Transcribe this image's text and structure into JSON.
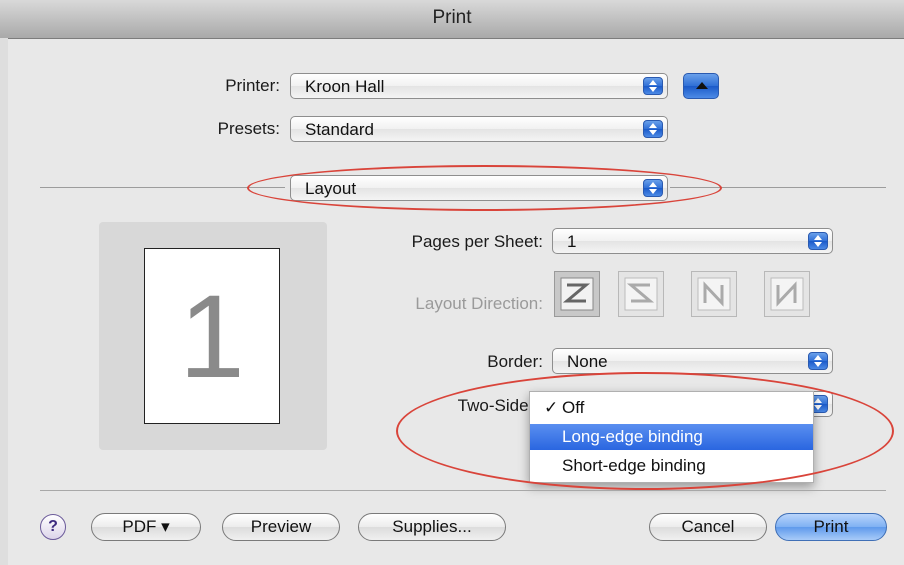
{
  "window": {
    "title": "Print"
  },
  "printer": {
    "label": "Printer:",
    "value": "Kroon Hall"
  },
  "presets": {
    "label": "Presets:",
    "value": "Standard"
  },
  "section": {
    "value": "Layout"
  },
  "preview": {
    "page_number": "1"
  },
  "pages_per_sheet": {
    "label": "Pages per Sheet:",
    "value": "1"
  },
  "layout_direction": {
    "label": "Layout Direction:"
  },
  "border": {
    "label": "Border:",
    "value": "None"
  },
  "two_sided": {
    "label": "Two-Sided",
    "options": [
      "Off",
      "Long-edge binding",
      "Short-edge binding"
    ],
    "checked_mark": "✓",
    "highlighted": "Long-edge binding"
  },
  "buttons": {
    "help": "?",
    "pdf": "PDF ▾",
    "preview": "Preview",
    "supplies": "Supplies...",
    "cancel": "Cancel",
    "print": "Print"
  },
  "colors": {
    "accent": "#2f6fd6",
    "annotation": "#d9443a",
    "highlight": "#3a74e6"
  }
}
